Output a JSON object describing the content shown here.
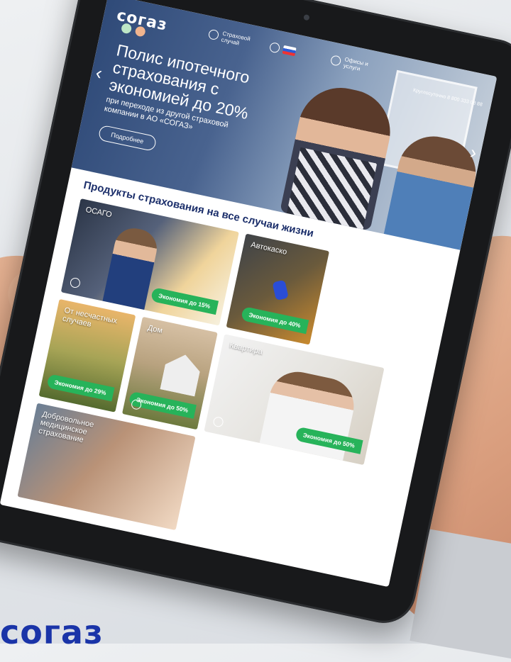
{
  "brand": {
    "logo": "согаз",
    "footer_logo": "согаз"
  },
  "header": {
    "nav": [
      {
        "label": "Страховой случай",
        "icon": "shield-icon"
      },
      {
        "label": "",
        "icon": "flag-icon"
      },
      {
        "label": "Офисы и услуги",
        "icon": "location-icon"
      }
    ],
    "hotline": "Круглосуточно 8 800 333 08 88"
  },
  "hero": {
    "title": "Полис ипотечного страхования с экономией до 20%",
    "subtitle": "при переходе из другой страховой компании в АО «СОГАЗ»",
    "button": "Подробнее",
    "prev": "‹",
    "next": "›"
  },
  "products": {
    "title": "Продукты страхования на все случаи жизни",
    "tiles": [
      {
        "name": "ОСАГО",
        "badge": "Экономия до 15%"
      },
      {
        "name": "Автокаско",
        "badge": "Экономия до 40%"
      },
      {
        "name": "От несчастных случаев",
        "badge": "Экономия до 29%"
      },
      {
        "name": "Дом",
        "badge": "Экономия до 50%"
      },
      {
        "name": "Квартира",
        "badge": "Экономия до 50%"
      },
      {
        "name": "Добровольное медицинское страхование",
        "badge": ""
      }
    ]
  },
  "colors": {
    "accent": "#27b35a",
    "brand": "#1a34a8",
    "title": "#1c2f6b"
  }
}
